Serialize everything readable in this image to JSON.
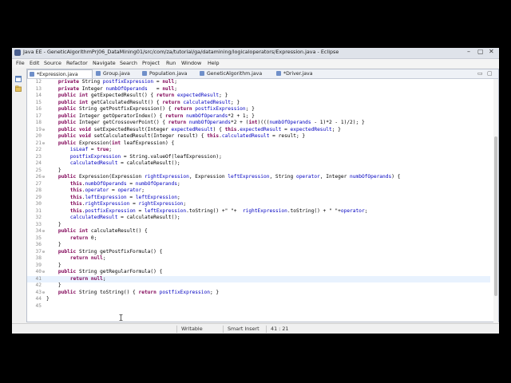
{
  "window": {
    "title": "Java EE - GeneticAlgorithmPrj06_DataMining01/src/com/za/tutorial/ga/datamining/logicaloperators/Expression.java - Eclipse",
    "controls": [
      "–",
      "▢",
      "✕"
    ]
  },
  "menu": [
    "File",
    "Edit",
    "Source",
    "Refactor",
    "Navigate",
    "Search",
    "Project",
    "Run",
    "Window",
    "Help"
  ],
  "tabs": [
    {
      "label": "*Expression.java",
      "active": true
    },
    {
      "label": "Group.java",
      "active": false
    },
    {
      "label": "Population.java",
      "active": false
    },
    {
      "label": "GeneticAlgorithm.java",
      "active": false
    },
    {
      "label": "*Driver.java",
      "active": false
    }
  ],
  "tab_controls": [
    "▭",
    "▢"
  ],
  "code_lines": [
    {
      "n": "12",
      "fold": "",
      "text": "    private String postfixExpression = null;"
    },
    {
      "n": "13",
      "fold": "",
      "text": "    private Integer numbOfOperands   = null;"
    },
    {
      "n": "14",
      "fold": "",
      "text": "    public int getExpectedResult() { return expectedResult; }"
    },
    {
      "n": "15",
      "fold": "",
      "text": "    public int getCalculatedResult() { return calculatedResult; }"
    },
    {
      "n": "16",
      "fold": "",
      "text": "    public String getPostfixExpression() { return postfixExpression; }"
    },
    {
      "n": "17",
      "fold": "",
      "text": "    public Integer getOperatorIndex() { return numbOfOperands*2 + 1; }"
    },
    {
      "n": "18",
      "fold": "",
      "text": "    public Integer getCrossoverPoint() { return numbOfOperands*2 + (int)(((numbOfOperands - 1)*2 - 1)/2); }"
    },
    {
      "n": "19",
      "fold": "⊖",
      "text": "    public void setExpectedResult(Integer expectedResult) { this.expectedResult = expectedResult; }"
    },
    {
      "n": "20",
      "fold": "",
      "text": "    public void setCalculatedResult(Integer result) { this.calculatedResult = result; }"
    },
    {
      "n": "21",
      "fold": "⊖",
      "text": "    public Expression(int leafExpression) {"
    },
    {
      "n": "22",
      "fold": "",
      "text": "        isLeaf = true;"
    },
    {
      "n": "23",
      "fold": "",
      "text": "        postfixExpression = String.valueOf(leafExpression);"
    },
    {
      "n": "24",
      "fold": "",
      "text": "        calculatedResult = calculateResult();"
    },
    {
      "n": "25",
      "fold": "",
      "text": "    }"
    },
    {
      "n": "26",
      "fold": "⊖",
      "text": "    public Expression(Expression rightExpression, Expression leftExpression, String operator, Integer numbOfOperands) {"
    },
    {
      "n": "27",
      "fold": "",
      "text": "        this.numbOfOperands = numbOfOperands;"
    },
    {
      "n": "28",
      "fold": "",
      "text": "        this.operator = operator;"
    },
    {
      "n": "29",
      "fold": "",
      "text": "        this.leftExpression = leftExpression;"
    },
    {
      "n": "30",
      "fold": "",
      "text": "        this.rightExpression = rightExpression;"
    },
    {
      "n": "31",
      "fold": "",
      "text": "        this.postfixExpression = leftExpression.toString() +\" \"+  rightExpression.toString() + \" \"+operator;"
    },
    {
      "n": "32",
      "fold": "",
      "text": "        calculatedResult = calculateResult();"
    },
    {
      "n": "33",
      "fold": "",
      "text": "    }"
    },
    {
      "n": "34",
      "fold": "⊖",
      "text": "    public int calculateResult() {"
    },
    {
      "n": "35",
      "fold": "",
      "text": "        return 0;"
    },
    {
      "n": "36",
      "fold": "",
      "text": "    }"
    },
    {
      "n": "37",
      "fold": "⊖",
      "text": "    public String getPostfixFormula() {"
    },
    {
      "n": "38",
      "fold": "",
      "text": "        return null;"
    },
    {
      "n": "39",
      "fold": "",
      "text": "    }"
    },
    {
      "n": "40",
      "fold": "⊖",
      "text": "    public String getRegularFormula() {"
    },
    {
      "n": "41",
      "fold": "",
      "text": "        return null;"
    },
    {
      "n": "42",
      "fold": "",
      "text": "    }"
    },
    {
      "n": "43",
      "fold": "⊖",
      "text": "    public String toString() { return postfixExpression; }"
    },
    {
      "n": "44",
      "fold": "",
      "text": "}"
    },
    {
      "n": "45",
      "fold": "",
      "text": ""
    }
  ],
  "current_line": "41",
  "status": {
    "writable": "Writable",
    "insert_mode": "Smart Insert",
    "position": "41 : 21"
  },
  "icons": {
    "app": "eclipse-icon",
    "left_tools": [
      "restore-icon",
      "package-icon"
    ],
    "cursor": "ibeam-cursor-icon"
  },
  "colors": {
    "keyword": "#7f0055",
    "field": "#0000c0",
    "current_line": "#e8f2fe",
    "tab_bar": "#eef1f6"
  }
}
